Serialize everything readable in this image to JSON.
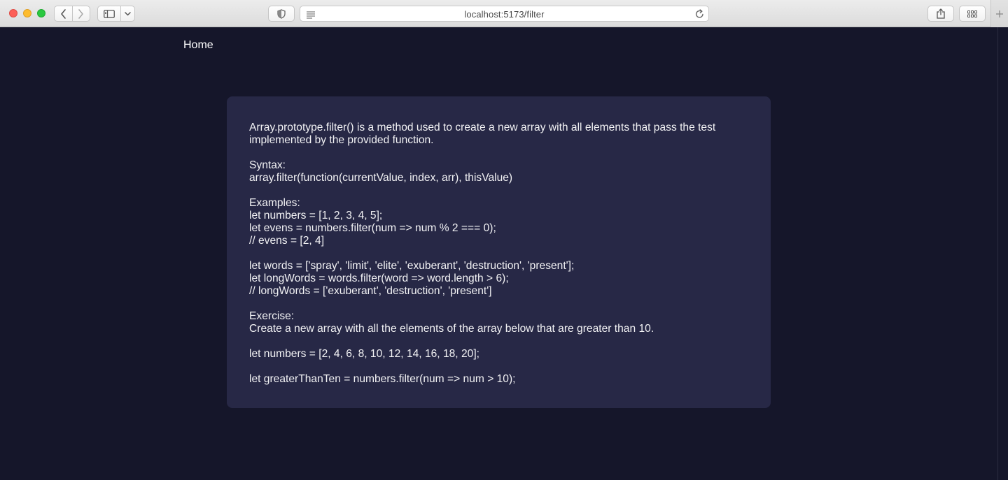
{
  "browser": {
    "url": "localhost:5173/filter",
    "icons": {
      "back": "chevron-left-icon",
      "forward": "chevron-right-icon",
      "sidebar": "sidebar-icon",
      "dropdown": "chevron-down-icon",
      "privacy": "shield-icon",
      "reader": "reader-lines-icon",
      "reload": "reload-icon",
      "share": "share-icon",
      "tabs": "grid-icon",
      "new_tab": "plus-icon"
    }
  },
  "nav": {
    "home_label": "Home"
  },
  "card": {
    "intro": "Array.prototype.filter() is a method used to create a new array with all elements that pass the test implemented by the provided function.",
    "syntax_heading": "Syntax:",
    "syntax_code": "array.filter(function(currentValue, index, arr), thisValue)",
    "examples_heading": "Examples:",
    "example1": [
      "let numbers = [1, 2, 3, 4, 5];",
      "let evens = numbers.filter(num => num % 2 === 0);",
      "// evens = [2, 4]"
    ],
    "example2": [
      "let words = ['spray', 'limit', 'elite', 'exuberant', 'destruction', 'present'];",
      "let longWords = words.filter(word => word.length > 6);",
      "// longWords = ['exuberant', 'destruction', 'present']"
    ],
    "exercise_heading": "Exercise:",
    "exercise_text": "Create a new array with all the elements of the array below that are greater than 10.",
    "exercise_array": "let numbers = [2, 4, 6, 8, 10, 12, 14, 16, 18, 20];",
    "exercise_answer": "let greaterThanTen = numbers.filter(num => num > 10);"
  },
  "colors": {
    "page_background": "#15162a",
    "card_background": "#272846",
    "text": "#f2f2f4"
  }
}
